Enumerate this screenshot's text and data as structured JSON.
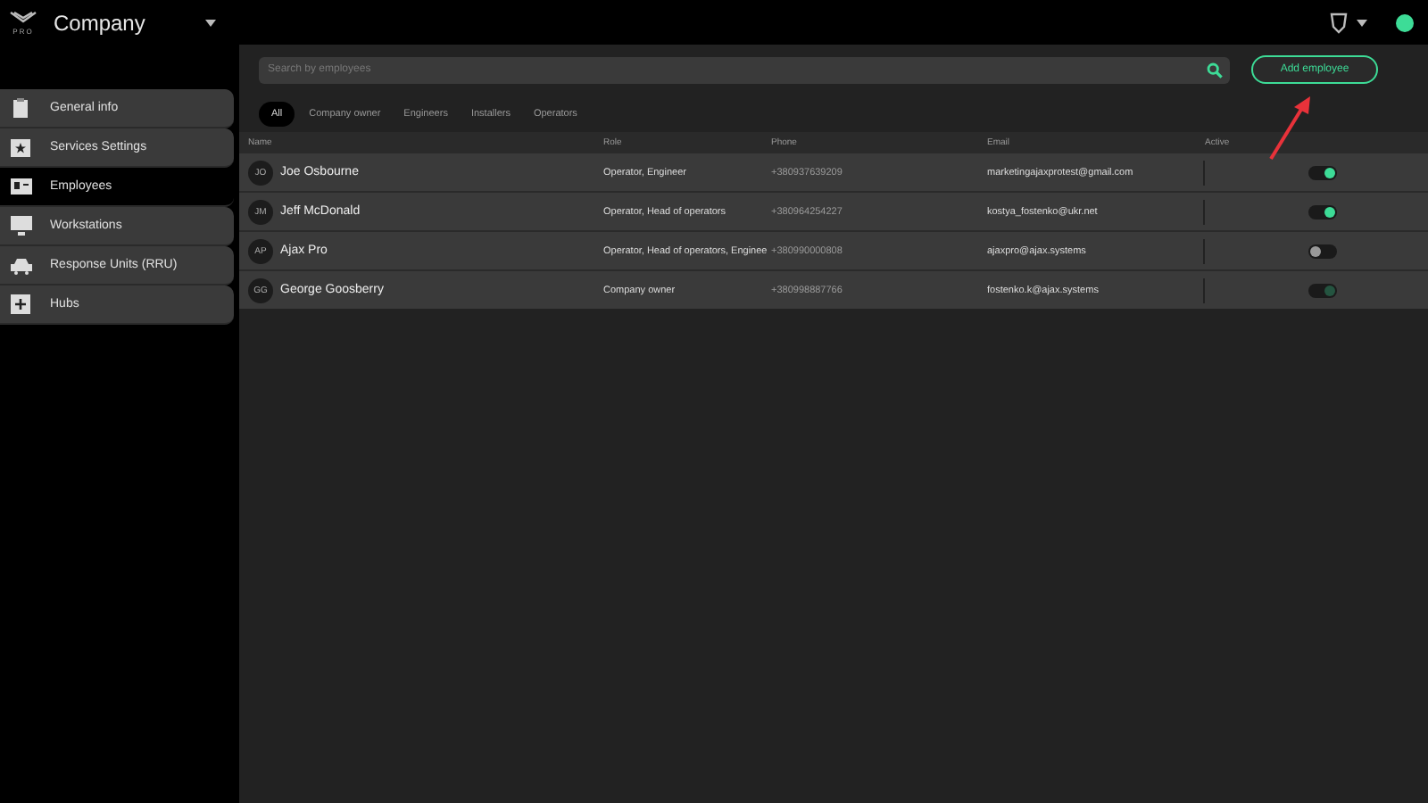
{
  "header": {
    "logo_text": "PRO",
    "company": "Company"
  },
  "sidebar": {
    "items": [
      {
        "label": "General info",
        "selected": false
      },
      {
        "label": "Services Settings",
        "selected": false
      },
      {
        "label": "Employees",
        "selected": true
      },
      {
        "label": "Workstations",
        "selected": false
      },
      {
        "label": "Response Units (RRU)",
        "selected": false
      },
      {
        "label": "Hubs",
        "selected": false
      }
    ]
  },
  "search": {
    "placeholder": "Search by employees"
  },
  "add_button": "Add employee",
  "filters": [
    {
      "label": "All",
      "selected": true
    },
    {
      "label": "Company owner",
      "selected": false
    },
    {
      "label": "Engineers",
      "selected": false
    },
    {
      "label": "Installers",
      "selected": false
    },
    {
      "label": "Operators",
      "selected": false
    }
  ],
  "table": {
    "columns": [
      "Name",
      "Role",
      "Phone",
      "Email",
      "Active"
    ],
    "rows": [
      {
        "initials": "JO",
        "name": "Joe Osbourne",
        "role": "Operator, Engineer",
        "phone": "+380937639209",
        "email": "marketingajaxprotest@gmail.com",
        "active": true,
        "disabled": false
      },
      {
        "initials": "JM",
        "name": "Jeff McDonald",
        "role": "Operator, Head of operators",
        "phone": "+380964254227",
        "email": "kostya_fostenko@ukr.net",
        "active": true,
        "disabled": false
      },
      {
        "initials": "AP",
        "name": "Ajax Pro",
        "role": "Operator, Head of operators, Enginee",
        "phone": "+380990000808",
        "email": "ajaxpro@ajax.systems",
        "active": false,
        "disabled": false
      },
      {
        "initials": "GG",
        "name": "George Goosberry",
        "role": "Company owner",
        "phone": "+380998887766",
        "email": "fostenko.k@ajax.systems",
        "active": true,
        "disabled": true
      }
    ]
  }
}
